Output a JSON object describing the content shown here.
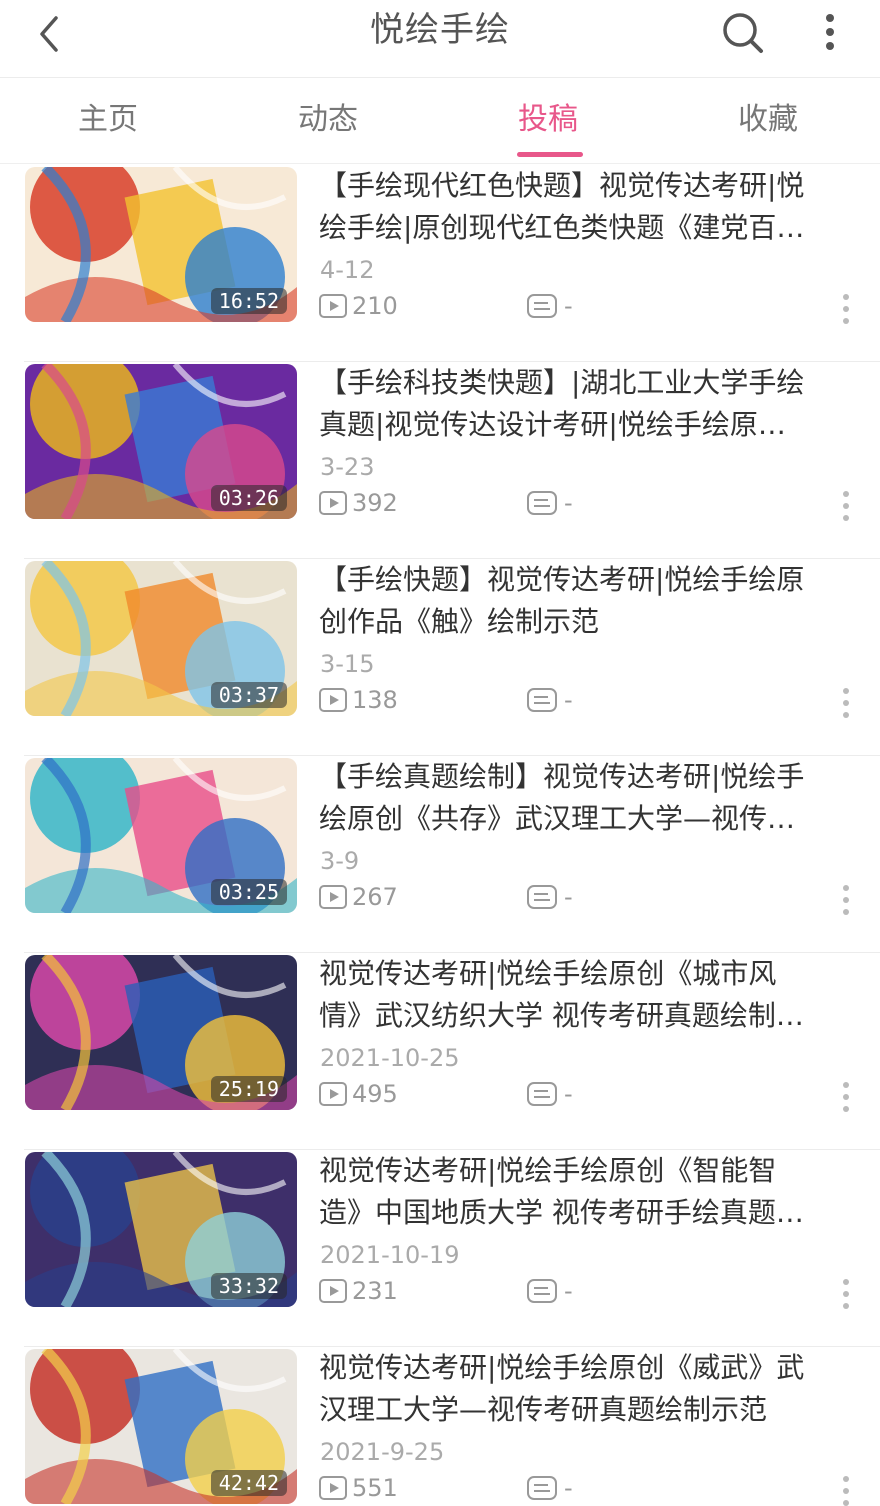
{
  "header": {
    "title": "悦绘手绘"
  },
  "tabs": [
    {
      "label": "主页"
    },
    {
      "label": "动态"
    },
    {
      "label": "投稿"
    },
    {
      "label": "收藏"
    }
  ],
  "active_tab": "投稿",
  "colors": {
    "accent": "#e8578a"
  },
  "videos": [
    {
      "title_line1": "【手绘现代红色快题】视觉传达考研|悦",
      "title_line2": "绘手绘|原创现代红色类快题《建党百…",
      "date": "4-12",
      "views": "210",
      "danmaku": "-",
      "duration": "16:52"
    },
    {
      "title_line1": "【手绘科技类快题】|湖北工业大学手绘",
      "title_line2": "真题|视觉传达设计考研|悦绘手绘原…",
      "date": "3-23",
      "views": "392",
      "danmaku": "-",
      "duration": "03:26"
    },
    {
      "title_line1": "【手绘快题】视觉传达考研|悦绘手绘原",
      "title_line2": "创作品《触》绘制示范",
      "date": "3-15",
      "views": "138",
      "danmaku": "-",
      "duration": "03:37"
    },
    {
      "title_line1": "【手绘真题绘制】视觉传达考研|悦绘手",
      "title_line2": "绘原创《共存》武汉理工大学—视传…",
      "date": "3-9",
      "views": "267",
      "danmaku": "-",
      "duration": "03:25"
    },
    {
      "title_line1": "视觉传达考研|悦绘手绘原创《城市风",
      "title_line2": "情》武汉纺织大学 视传考研真题绘制…",
      "date": "2021-10-25",
      "views": "495",
      "danmaku": "-",
      "duration": "25:19"
    },
    {
      "title_line1": "视觉传达考研|悦绘手绘原创《智能智",
      "title_line2": "造》中国地质大学  视传考研手绘真题…",
      "date": "2021-10-19",
      "views": "231",
      "danmaku": "-",
      "duration": "33:32"
    },
    {
      "title_line1": "视觉传达考研|悦绘手绘原创《威武》武",
      "title_line2": "汉理工大学—视传考研真题绘制示范",
      "date": "2021-9-25",
      "views": "551",
      "danmaku": "-",
      "duration": "42:42"
    }
  ]
}
